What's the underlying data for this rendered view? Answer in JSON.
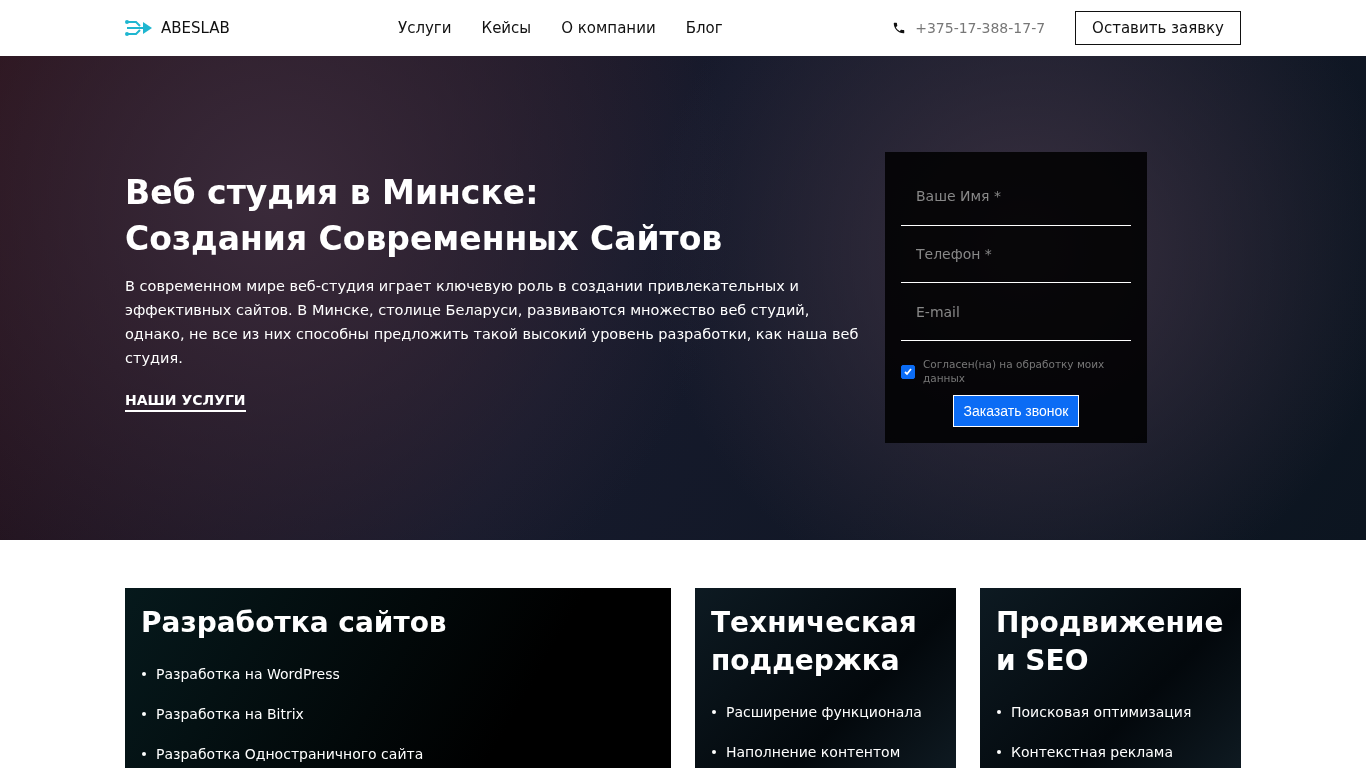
{
  "header": {
    "logo": "ABESLAB",
    "nav": [
      {
        "label": "Услуги"
      },
      {
        "label": "Кейсы"
      },
      {
        "label": "О компании"
      },
      {
        "label": "Блог"
      }
    ],
    "phone": "+375-17-388-17-7",
    "cta": "Оставить заявку"
  },
  "hero": {
    "title_lines": [
      "Веб студия в Минске:",
      "Создания Современных Сайтов"
    ],
    "text": "В современном мире веб-студия играет ключевую роль в создании привлекательных и эффективных сайтов. В Минске, столице Беларуси, развиваются множество веб студий, однако, не все из них способны предложить такой высокий уровень разработки, как наша веб студия.",
    "link": "НАШИ УСЛУГИ"
  },
  "form": {
    "fields": [
      {
        "placeholder": "Ваше Имя *"
      },
      {
        "placeholder": "Телефон *"
      },
      {
        "placeholder": "E-mail"
      }
    ],
    "consent": {
      "label": "Согласен(на) на обработку моих данных",
      "checked": true
    },
    "submit": "Заказать звонок"
  },
  "cards": [
    {
      "title": "Разработка сайтов",
      "items": [
        "Разработка на WordPress",
        "Разработка на Bitrix",
        "Разработка Одностраничного сайта"
      ]
    },
    {
      "title": "Техническая поддержка",
      "items": [
        "Расширение функционала",
        "Наполнение контентом"
      ]
    },
    {
      "title": "Продвижение и SEO",
      "items": [
        "Поисковая оптимизация",
        "Контекстная реклама"
      ]
    }
  ]
}
